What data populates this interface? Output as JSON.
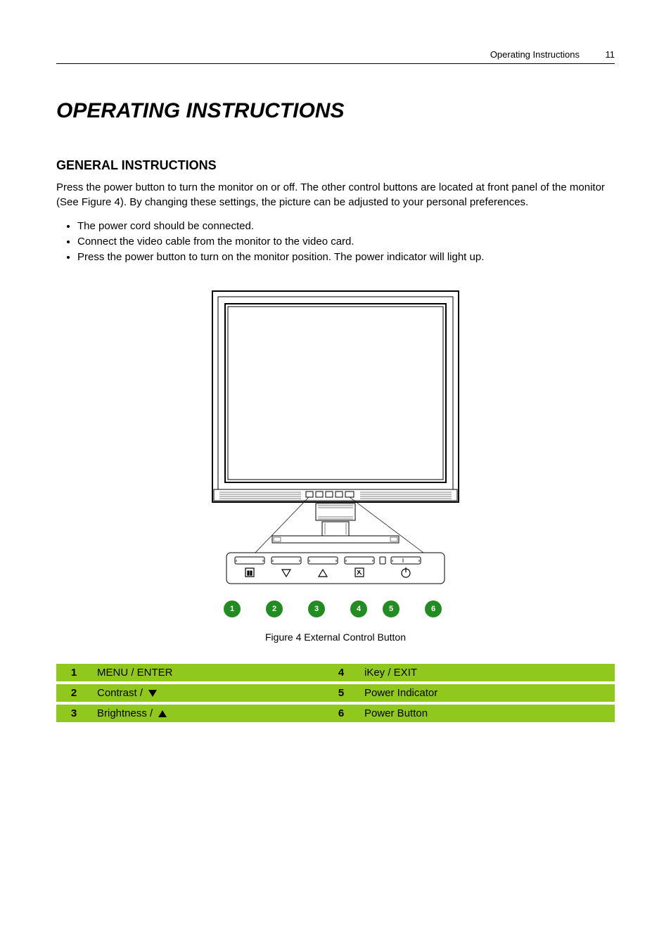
{
  "header": {
    "running": "Operating Instructions",
    "page": "11"
  },
  "title": "OPERATING INSTRUCTIONS",
  "general": {
    "heading": "GENERAL INSTRUCTIONS",
    "paragraph": "Press the power button to turn the monitor on or off. The other control buttons are located at front panel of the monitor (See Figure 4). By changing these settings, the picture can be adjusted to your personal preferences.",
    "bullets": [
      "The power cord should be connected.",
      "Connect the video cable from the monitor to the video card.",
      "Press the power button to turn on the monitor position. The power indicator will light up."
    ]
  },
  "figure": {
    "caption": "Figure 4 External Control Button"
  },
  "controls": {
    "b1_num": "1",
    "b1_label": "MENU / ENTER",
    "b2_num": "2",
    "b2_label": "Contrast /",
    "b3_num": "3",
    "b3_label": "Brightness /",
    "b4_num": "4",
    "b4_label": "iKey / EXIT",
    "b5_num": "5",
    "b5_label": "Power Indicator",
    "b6_num": "6",
    "b6_label": "Power Button",
    "btn1": "1",
    "btn2": "2",
    "btn3": "3",
    "btn4": "4",
    "btn5": "5",
    "btn6": "6"
  }
}
